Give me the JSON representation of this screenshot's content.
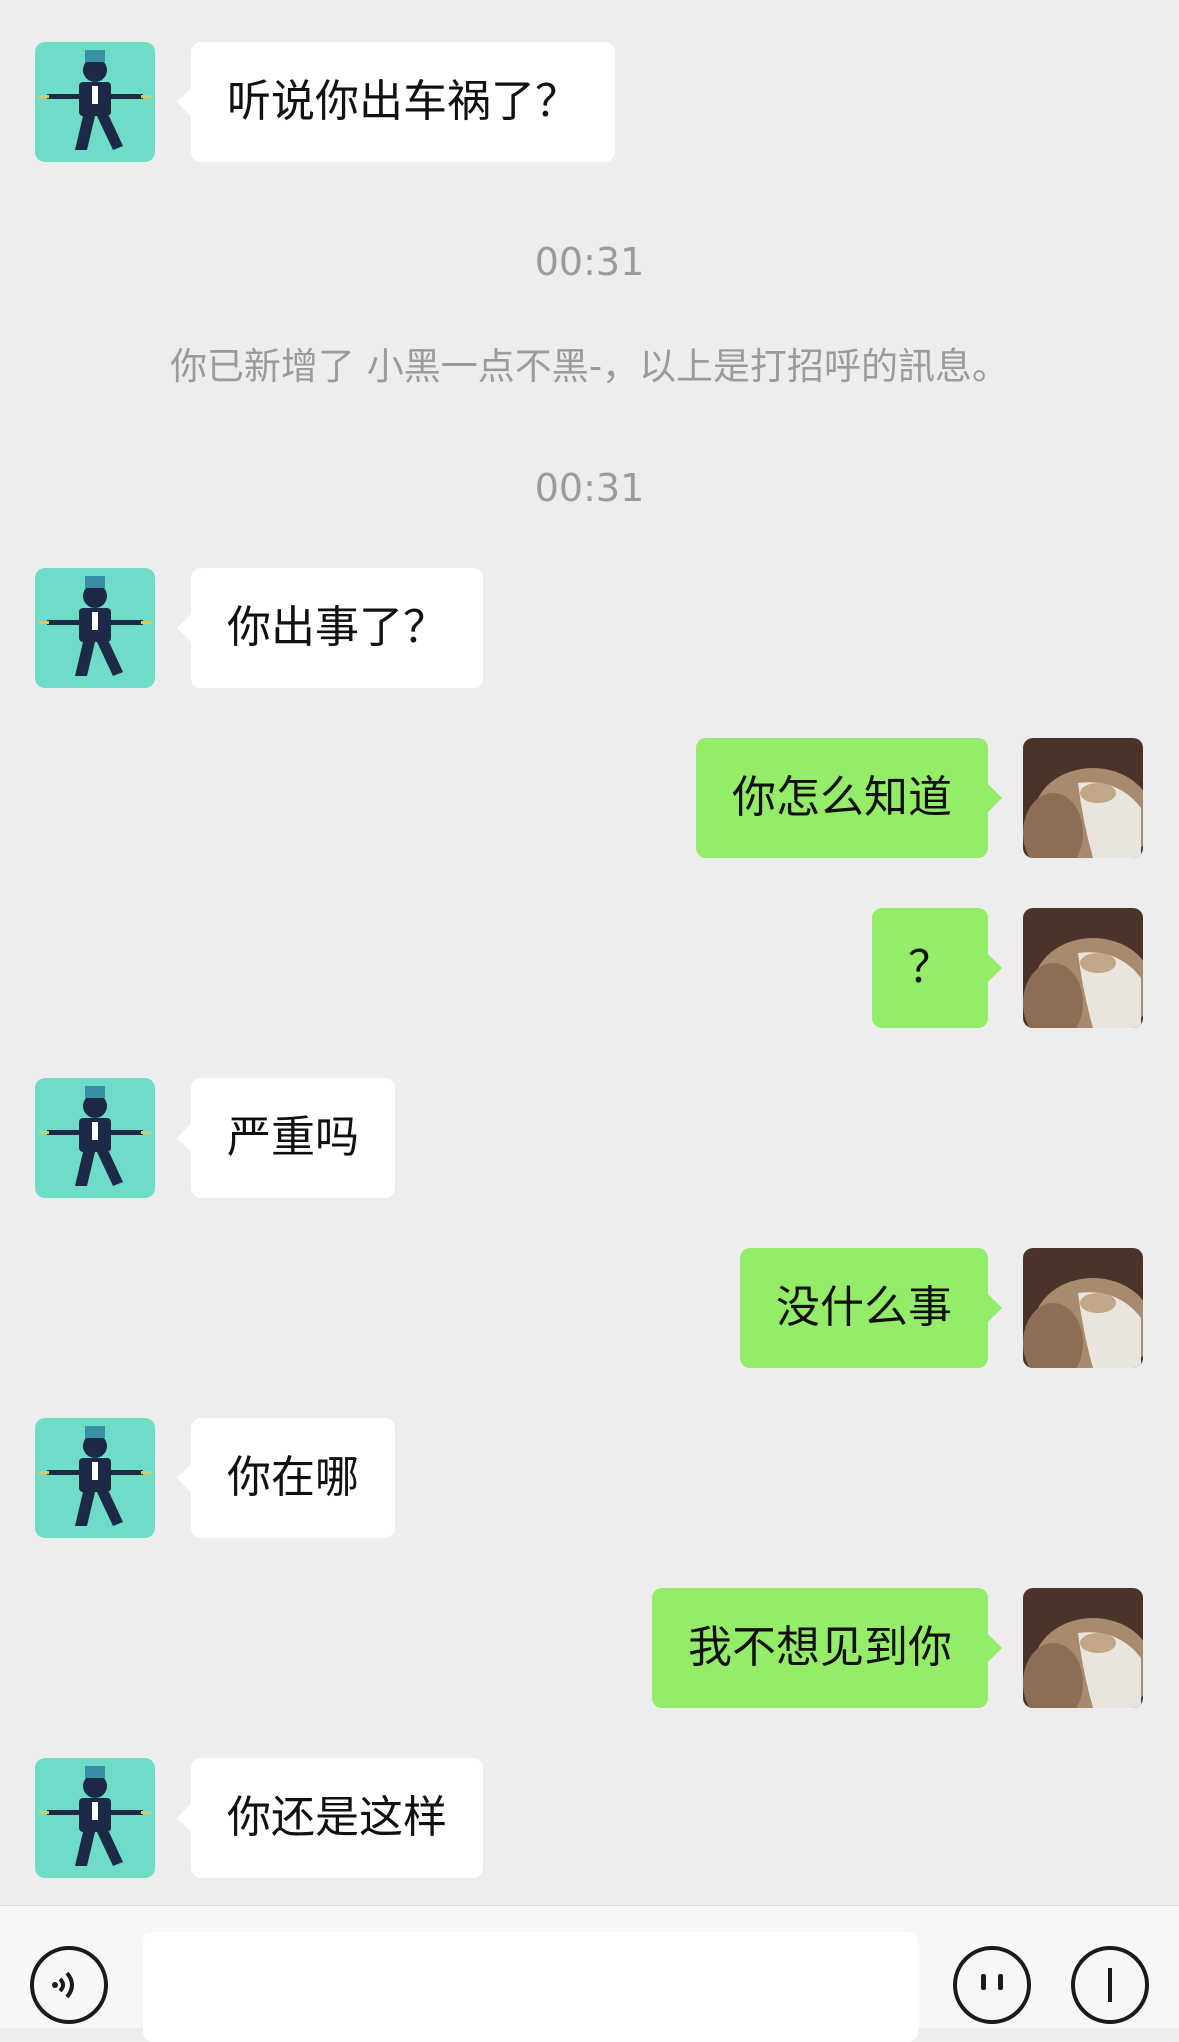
{
  "messages": [
    {
      "side": "left",
      "text": "听说你出车祸了？"
    },
    {
      "time": "00:31"
    },
    {
      "system": "你已新增了 小黑一点不黑-，以上是打招呼的訊息。"
    },
    {
      "time": "00:31"
    },
    {
      "side": "left",
      "text": "你出事了？"
    },
    {
      "side": "right",
      "text": "你怎么知道"
    },
    {
      "side": "right",
      "text": "？"
    },
    {
      "side": "left",
      "text": "严重吗"
    },
    {
      "side": "right",
      "text": "没什么事"
    },
    {
      "side": "left",
      "text": "你在哪"
    },
    {
      "side": "right",
      "text": "我不想见到你"
    },
    {
      "side": "left",
      "text": "你还是这样"
    }
  ],
  "input_bar": {
    "voice_icon": "voice-icon",
    "emoji_icon": "emoji-icon",
    "plus_icon": "plus-icon"
  },
  "colors": {
    "background": "#ededed",
    "incoming_bubble": "#ffffff",
    "outgoing_bubble": "#95ec69",
    "meta_text": "#9b9b9b"
  }
}
